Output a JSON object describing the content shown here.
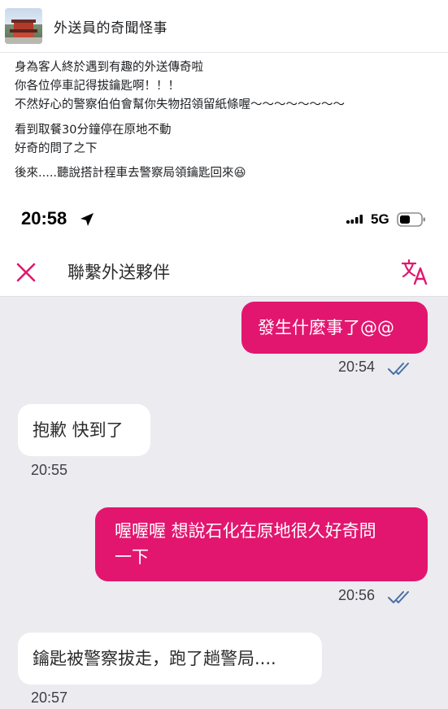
{
  "post": {
    "group_name": "外送員的奇聞怪事",
    "lines": [
      "身為客人終於遇到有趣的外送傳奇啦",
      "你各位停車記得拔鑰匙啊！！！",
      "不然好心的警察伯伯會幫你失物招領留紙條喔～～～～～～～～",
      "看到取餐30分鐘停在原地不動",
      "好奇的問了之下",
      "後來.....聽說搭計程車去警察局領鑰匙回來😆"
    ]
  },
  "phone": {
    "status_bar": {
      "time": "20:58",
      "network": "5G",
      "icons": [
        "location-arrow-icon",
        "signal-icon",
        "battery-icon"
      ]
    },
    "chat_header": {
      "title": "聯繫外送夥伴",
      "icons": [
        "close-icon",
        "translate-icon"
      ]
    },
    "messages": [
      {
        "direction": "outgoing",
        "text": "發生什麼事了@@",
        "time": "20:54",
        "read": true
      },
      {
        "direction": "incoming",
        "text": "抱歉 快到了",
        "time": "20:55"
      },
      {
        "direction": "outgoing",
        "text_line1": "喔喔喔 想說石化在原地很久好奇問",
        "text_line2": "一下",
        "time": "20:56",
        "read": true
      },
      {
        "direction": "incoming",
        "text": "鑰匙被警察拔走，跑了趟警局....",
        "time": "20:57"
      }
    ]
  },
  "colors": {
    "outgoing_bubble": "#e2166f",
    "incoming_bubble": "#ffffff",
    "chat_background": "#ebebf0",
    "read_ticks": "#4a6fa5",
    "accent_icon": "#e2166f"
  }
}
